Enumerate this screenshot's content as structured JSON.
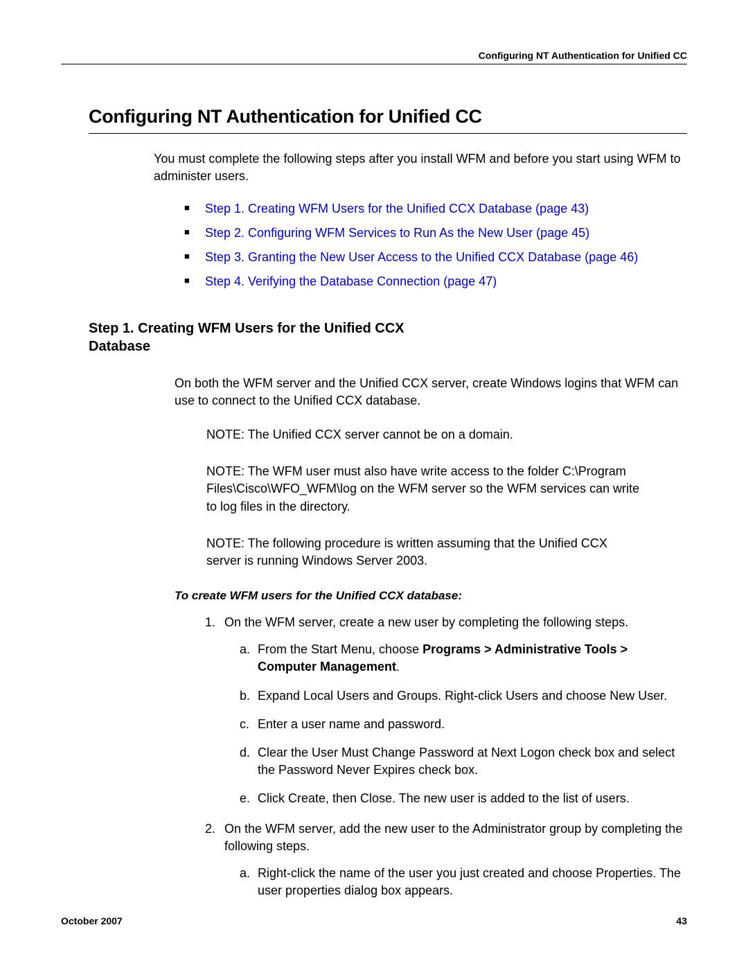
{
  "runningHeader": "Configuring NT Authentication for Unified CC",
  "sectionTitle": "Configuring NT Authentication for Unified CC",
  "intro": "You must complete the following steps after you install WFM and before you start using WFM to administer users.",
  "bullets": [
    "Step 1. Creating WFM Users for the Unified CCX Database (page 43)",
    "Step 2. Configuring WFM Services to Run As the New User (page 45)",
    "Step 3. Granting the New User Access to the Unified CCX Database (page 46)",
    "Step 4. Verifying the Database Connection (page 47)"
  ],
  "subsectionTitle": "Step 1. Creating WFM Users for the Unified CCX Database",
  "body1": "On both the WFM server and the Unified CCX server, create Windows logins that WFM can use to connect to the Unified CCX database.",
  "note1Prefix": "NOTE:  ",
  "note1": "The Unified CCX server cannot be on a domain.",
  "note2Prefix": "NOTE:  ",
  "note2": "The WFM user must also have write access to the folder C:\\Program Files\\Cisco\\WFO_WFM\\log on the WFM server so the WFM services can write to log files in the directory.",
  "note3Prefix": "NOTE:  ",
  "note3": "The following procedure is written assuming that the Unified CCX server is running Windows Server 2003.",
  "procedureTitle": "To create WFM users for the Unified CCX database:",
  "steps": {
    "s1": {
      "num": "1.",
      "text": "On the WFM server, create a new user by completing the following steps.",
      "a": {
        "alpha": "a.",
        "textPre": "From the Start Menu, choose ",
        "bold": "Programs > Administrative Tools > Computer Management",
        "textPost": "."
      },
      "b": {
        "alpha": "b.",
        "text": "Expand Local Users and Groups. Right-click Users and choose New User."
      },
      "c": {
        "alpha": "c.",
        "text": "Enter a user name and password."
      },
      "d": {
        "alpha": "d.",
        "text": "Clear the User Must Change Password at Next Logon check box and select the Password Never Expires check box."
      },
      "e": {
        "alpha": "e.",
        "text": "Click Create, then Close. The new user is added to the list of users."
      }
    },
    "s2": {
      "num": "2.",
      "text": "On the WFM server, add the new user to the Administrator group by completing the following steps.",
      "a": {
        "alpha": "a.",
        "text": "Right-click the name of the user you just created and choose Properties. The user properties dialog box appears."
      }
    }
  },
  "footer": {
    "date": "October 2007",
    "page": "43"
  }
}
